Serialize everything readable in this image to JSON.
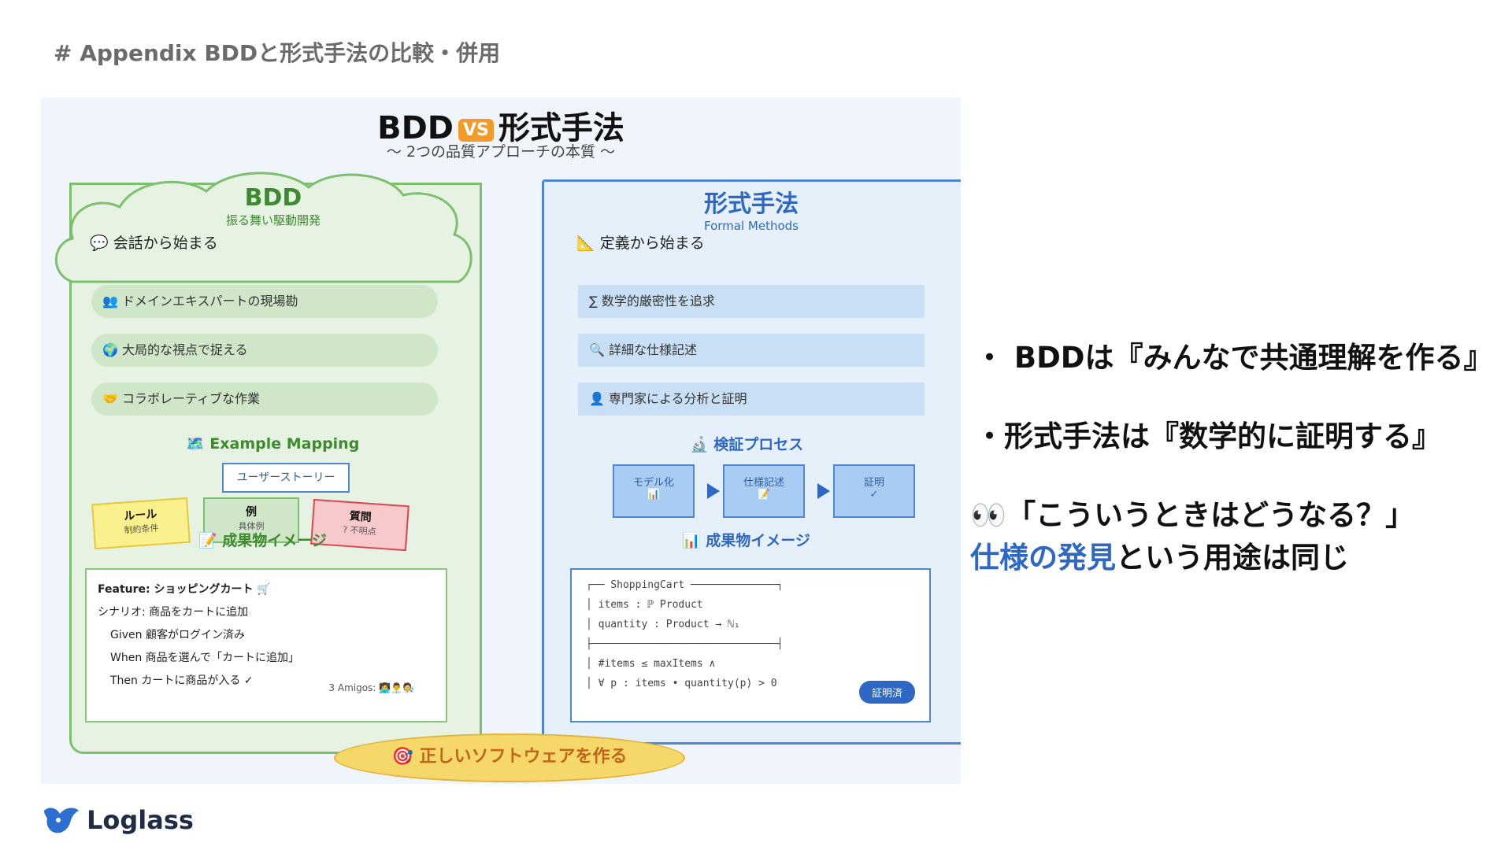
{
  "slide_title": "# Appendix BDDと形式手法の比較・併用",
  "figure": {
    "title_left": "BDD",
    "vs_label": "VS",
    "title_right": "形式手法",
    "subtitle": "〜 2つの品質アプローチの本質 〜",
    "bdd": {
      "heading": "BDD",
      "subheading": "振る舞い駆動開発",
      "opener": "💬 会話から始まる",
      "items": [
        "👥 ドメインエキスパートの現場勘",
        "🌍 大局的な視点で捉える",
        "🤝 コラボレーティブな作業"
      ],
      "example_mapping_title": "🗺️ Example Mapping",
      "story": "ユーザーストーリー",
      "cards": [
        {
          "title": "ルール",
          "desc": "制約条件"
        },
        {
          "title": "例",
          "desc": "具体例"
        },
        {
          "title": "質問",
          "desc": "? 不明点"
        }
      ],
      "artifact_title": "📝 成果物イメージ",
      "feature_lines": [
        "Feature: ショッピングカート 🛒",
        "シナリオ: 商品をカートに追加",
        "Given 顧客がログイン済み",
        "When 商品を選んで「カートに追加」",
        "Then カートに商品が入る ✓"
      ],
      "amigos": "3 Amigos:",
      "amigos_icons": "👩‍💻👨‍💼🧑‍🔬"
    },
    "fm": {
      "heading": "形式手法",
      "subheading": "Formal Methods",
      "opener": "📐 定義から始まる",
      "items": [
        "∑ 数学的厳密性を追求",
        "🔍 詳細な仕様記述",
        "👤 専門家による分析と証明"
      ],
      "process_title": "🔬 検証プロセス",
      "flow": [
        {
          "label": "モデル化",
          "icon": "📊"
        },
        {
          "label": "仕様記述",
          "icon": "📝"
        },
        {
          "label": "証明",
          "icon": "✓"
        }
      ],
      "artifact_title": "📊 成果物イメージ",
      "schema_lines": [
        "┌── ShoppingCart ──────────────┐",
        "│ items : ℙ Product",
        "│ quantity : Product → ℕ₁",
        "├──────────────────────────────┤",
        "│ #items ≤ maxItems ∧",
        "│ ∀ p : items • quantity(p) > 0"
      ],
      "proved_label": "証明済"
    },
    "goal": "🎯 正しいソフトウェアを作る"
  },
  "bullets": [
    "・ BDDは『みんなで共通理解を作る』",
    "・形式手法は『数学的に証明する』"
  ],
  "question_icon": "👀",
  "question": "「こういうときはどうなる？」",
  "conclusion_highlight": "仕様の発見",
  "conclusion_rest": "という用途は同じ",
  "logo_text": "Loglass"
}
